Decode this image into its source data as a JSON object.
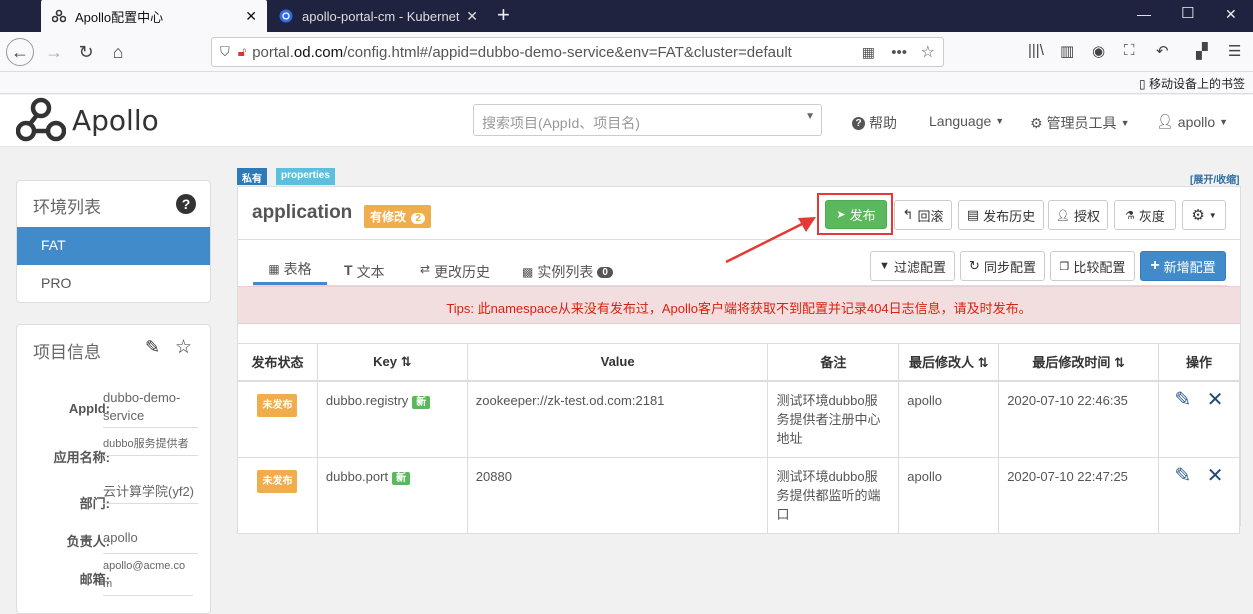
{
  "browser": {
    "tabs": [
      {
        "title": "Apollo配置中心",
        "active": true
      },
      {
        "title": "apollo-portal-cm - Kubernet",
        "active": false
      }
    ],
    "url": {
      "prefix": "portal.",
      "domain": "od.com",
      "path": "/config.html#/appid=dubbo-demo-service&env=FAT&cluster=default"
    },
    "mobile_bookmarks": "移动设备上的书签"
  },
  "header": {
    "logo_text": "Apollo",
    "search_placeholder": "搜索项目(AppId、项目名)",
    "help": "帮助",
    "language": "Language",
    "admin_tools": "管理员工具",
    "user": "apollo"
  },
  "sidebar": {
    "env_title": "环境列表",
    "envs": [
      "FAT",
      "PRO"
    ],
    "project_title": "项目信息",
    "info": [
      {
        "label": "AppId:",
        "value": "dubbo-demo-service"
      },
      {
        "label": "应用名称:",
        "value": "dubbo服务提供者"
      },
      {
        "label": "部门:",
        "value": "云计算学院(yf2)"
      },
      {
        "label": "负责人:",
        "value": "apollo"
      },
      {
        "label": "邮箱:",
        "value": "apollo@acme.com"
      }
    ]
  },
  "namespace": {
    "badge_private": "私有",
    "badge_format": "properties",
    "expand_toggle": "[展开/收缩]",
    "name": "application",
    "modified_label": "有修改",
    "modified_count": "2",
    "buttons": {
      "publish": "发布",
      "rollback": "回滚",
      "history": "发布历史",
      "grant": "授权",
      "gray": "灰度"
    },
    "tabs": {
      "table": "表格",
      "text": "文本",
      "change_history": "更改历史",
      "instances": "实例列表",
      "instances_count": "0"
    },
    "actions": {
      "filter": "过滤配置",
      "sync": "同步配置",
      "compare": "比较配置",
      "add": "新增配置"
    },
    "tips": "Tips: 此namespace从来没有发布过，Apollo客户端将获取不到配置并记录404日志信息，请及时发布。"
  },
  "table": {
    "headers": [
      "发布状态",
      "Key",
      "Value",
      "备注",
      "最后修改人",
      "最后修改时间",
      "操作"
    ],
    "rows": [
      {
        "status": "未发布",
        "key": "dubbo.registry",
        "new": "新",
        "value": "zookeeper://zk-test.od.com:2181",
        "comment": "测试环境dubbo服务提供者注册中心地址",
        "modifier": "apollo",
        "time": "2020-07-10 22:46:35"
      },
      {
        "status": "未发布",
        "key": "dubbo.port",
        "new": "新",
        "value": "20880",
        "comment": "测试环境dubbo服务提供都监听的端口",
        "modifier": "apollo",
        "time": "2020-07-10 22:47:25"
      }
    ]
  },
  "colors": {
    "primary": "#428bca",
    "publish_green": "#5cb85c",
    "warning": "#f0ad4e",
    "danger": "#d9534f",
    "highlight_red": "#e53935"
  }
}
